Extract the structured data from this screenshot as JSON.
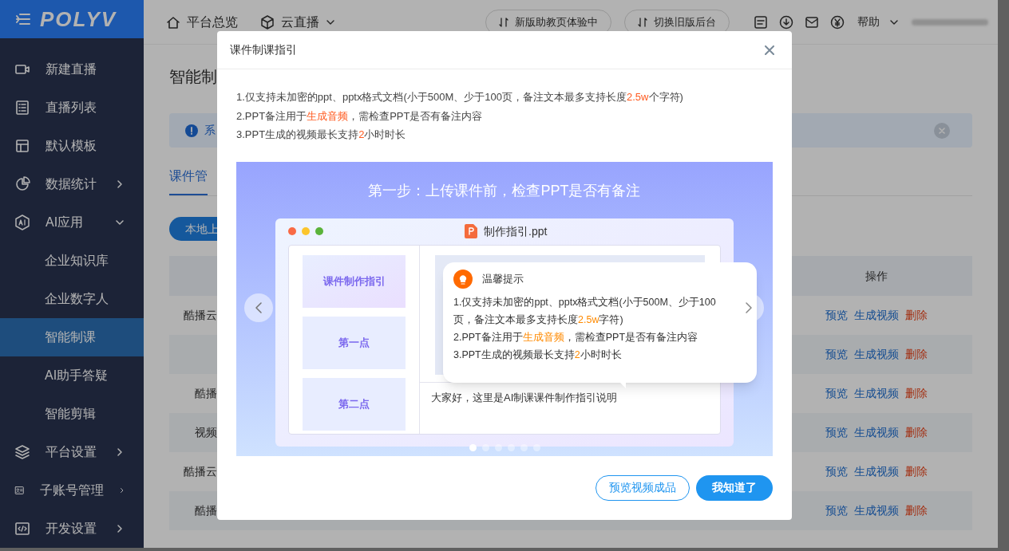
{
  "header": {
    "logo": "POLYV",
    "nav": [
      {
        "label": "平台总览",
        "dropdown": false
      },
      {
        "label": "云直播",
        "dropdown": true
      }
    ],
    "buttons": [
      "新版助教页体验中",
      "切换旧版后台"
    ],
    "help": "帮助"
  },
  "sidebar": {
    "items": [
      {
        "label": "新建直播",
        "selected": false
      },
      {
        "label": "直播列表",
        "selected": false
      },
      {
        "label": "默认模板",
        "selected": false
      },
      {
        "label": "数据统计",
        "selected": false,
        "expanded": false
      },
      {
        "label": "AI应用",
        "selected": false,
        "expanded": true,
        "children": [
          {
            "label": "企业知识库",
            "selected": false
          },
          {
            "label": "企业数字人",
            "selected": false
          },
          {
            "label": "智能制课",
            "selected": true
          },
          {
            "label": "AI助手答疑",
            "selected": false
          },
          {
            "label": "智能剪辑",
            "selected": false
          }
        ]
      },
      {
        "label": "平台设置",
        "selected": false,
        "expanded": false
      },
      {
        "label": "子账号管理",
        "selected": false,
        "expanded": false
      },
      {
        "label": "开发设置",
        "selected": false,
        "expanded": false
      }
    ]
  },
  "page": {
    "title": "智能制",
    "alert": "系",
    "tabs": [
      {
        "label": "课件管",
        "selected": true
      }
    ],
    "upload_button": "本地上",
    "table": {
      "columns": [
        "操作"
      ],
      "rows": [
        {
          "name": "酷播云",
          "actions": [
            {
              "label": "预览",
              "kind": "link"
            },
            {
              "label": "生成视频",
              "kind": "link"
            },
            {
              "label": "删除",
              "kind": "danger"
            }
          ]
        },
        {
          "actions": [
            {
              "label": "预览",
              "kind": "link"
            },
            {
              "label": "生成视频",
              "kind": "link"
            },
            {
              "label": "删除",
              "kind": "danger"
            }
          ]
        },
        {
          "name": "酷播",
          "actions": [
            {
              "label": "预览",
              "kind": "link"
            },
            {
              "label": "生成视频",
              "kind": "link"
            },
            {
              "label": "删除",
              "kind": "danger"
            }
          ]
        },
        {
          "name": "视频",
          "actions": [
            {
              "label": "预览",
              "kind": "link"
            },
            {
              "label": "生成视频",
              "kind": "link"
            },
            {
              "label": "删除",
              "kind": "danger"
            }
          ]
        },
        {
          "name": "酷播云",
          "actions": [
            {
              "label": "预览",
              "kind": "link"
            },
            {
              "label": "生成视频",
              "kind": "link"
            },
            {
              "label": "删除",
              "kind": "danger"
            }
          ]
        },
        {
          "name": "酷播",
          "actions": [
            {
              "label": "预览",
              "kind": "link"
            },
            {
              "label": "生成视频",
              "kind": "link"
            },
            {
              "label": "删除",
              "kind": "danger"
            }
          ]
        }
      ]
    }
  },
  "dialog": {
    "title": "课件制课指引",
    "notes": [
      "1.仅支持未加密的ppt、pptx格式文档(小于500M、少于100页，备注文本最多支持长度**2.5w**个字符)",
      "2.PPT备注用于**生成音频**，需检查PPT是否有备注内容",
      "3.PPT生成的视频最长支持**2**小时时长"
    ],
    "slide": {
      "title": "第一步：上传课件前，检查PPT是否有备注",
      "file_name": "制作指引.ppt",
      "thumbnails": [
        "课件制作指引",
        "第一点",
        "第二点"
      ],
      "speaker_note": "大家好，这里是AI制课课件制作指引说明",
      "tip_title": "温馨提示",
      "tip_lines": [
        "1.仅支持未加密的ppt、pptx格式文档(小于500M、少于100页，备注文本最多支持长度**2.5w**字符)",
        "2.PPT备注用于**生成音频**，需检查PPT是否有备注内容",
        "3.PPT生成的视频最长支持**2**小时时长"
      ],
      "pages": [
        {
          "selected": true
        },
        {
          "selected": false
        },
        {
          "selected": false
        },
        {
          "selected": false
        },
        {
          "selected": false
        },
        {
          "selected": false
        }
      ]
    },
    "buttons": [
      {
        "label": "预览视频成品",
        "kind": "outline"
      },
      {
        "label": "我知道了",
        "kind": "primary"
      }
    ]
  }
}
